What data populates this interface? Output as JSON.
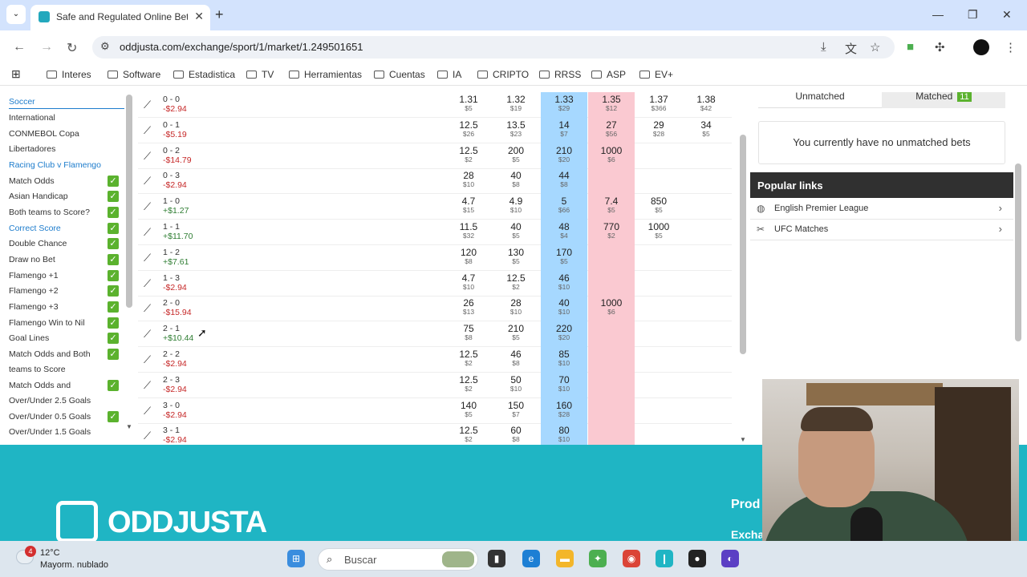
{
  "browser": {
    "tab_title": "Safe and Regulated Online Betti",
    "url": "oddjusta.com/exchange/sport/1/market/1.249501651"
  },
  "bookmarks": [
    "Interes",
    "Software",
    "Estadistica",
    "TV",
    "Herramientas",
    "Cuentas",
    "IA",
    "CRIPTO",
    "RRSS",
    "ASP",
    "EV+"
  ],
  "sidebar": {
    "items": [
      {
        "label": "Soccer",
        "style": "hl",
        "checked": false
      },
      {
        "label": "International",
        "style": "",
        "checked": false
      },
      {
        "label": "CONMEBOL Copa",
        "style": "",
        "checked": false
      },
      {
        "label": "Libertadores",
        "style": "",
        "checked": false
      },
      {
        "label": "Racing Club v Flamengo",
        "style": "hl",
        "checked": false
      },
      {
        "label": "Match Odds",
        "style": "",
        "checked": true
      },
      {
        "label": "Asian Handicap",
        "style": "",
        "checked": true
      },
      {
        "label": "Both teams to Score?",
        "style": "",
        "checked": true
      },
      {
        "label": "Correct Score",
        "style": "hl",
        "checked": true
      },
      {
        "label": "Double Chance",
        "style": "",
        "checked": true
      },
      {
        "label": "Draw no Bet",
        "style": "",
        "checked": true
      },
      {
        "label": "Flamengo +1",
        "style": "",
        "checked": true
      },
      {
        "label": "Flamengo +2",
        "style": "",
        "checked": true
      },
      {
        "label": "Flamengo +3",
        "style": "",
        "checked": true
      },
      {
        "label": "Flamengo Win to Nil",
        "style": "",
        "checked": true
      },
      {
        "label": "Goal Lines",
        "style": "",
        "checked": true
      },
      {
        "label": "Match Odds and Both",
        "style": "",
        "checked": true
      },
      {
        "label": "teams to Score",
        "style": "",
        "checked": false
      },
      {
        "label": "Match Odds and",
        "style": "",
        "checked": true
      },
      {
        "label": "Over/Under 2.5 Goals",
        "style": "",
        "checked": false
      },
      {
        "label": "Over/Under 0.5 Goals",
        "style": "",
        "checked": true
      },
      {
        "label": "Over/Under 1.5 Goals",
        "style": "",
        "checked": false
      }
    ]
  },
  "market": {
    "rows": [
      {
        "name": "0 - 0",
        "pl": "-$2.94",
        "pl_sign": "neg",
        "odds": [
          [
            "1.31",
            "$5"
          ],
          [
            "1.32",
            "$19"
          ],
          [
            "1.33",
            "$29"
          ],
          [
            "1.35",
            "$12"
          ],
          [
            "1.37",
            "$366"
          ],
          [
            "1.38",
            "$42"
          ]
        ]
      },
      {
        "name": "0 - 1",
        "pl": "-$5.19",
        "pl_sign": "neg",
        "odds": [
          [
            "12.5",
            "$26"
          ],
          [
            "13.5",
            "$23"
          ],
          [
            "14",
            "$7"
          ],
          [
            "27",
            "$56"
          ],
          [
            "29",
            "$28"
          ],
          [
            "34",
            "$5"
          ]
        ]
      },
      {
        "name": "0 - 2",
        "pl": "-$14.79",
        "pl_sign": "neg",
        "odds": [
          [
            "12.5",
            "$2"
          ],
          [
            "200",
            "$5"
          ],
          [
            "210",
            "$20"
          ],
          [
            "1000",
            "$6"
          ],
          [
            "",
            ""
          ],
          [
            "",
            ""
          ]
        ]
      },
      {
        "name": "0 - 3",
        "pl": "-$2.94",
        "pl_sign": "neg",
        "odds": [
          [
            "28",
            "$10"
          ],
          [
            "40",
            "$8"
          ],
          [
            "44",
            "$8"
          ],
          [
            "",
            ""
          ],
          [
            "",
            ""
          ],
          [
            "",
            ""
          ]
        ]
      },
      {
        "name": "1 - 0",
        "pl": "+$1.27",
        "pl_sign": "pos",
        "odds": [
          [
            "4.7",
            "$15"
          ],
          [
            "4.9",
            "$10"
          ],
          [
            "5",
            "$66"
          ],
          [
            "7.4",
            "$5"
          ],
          [
            "850",
            "$5"
          ],
          [
            "",
            ""
          ]
        ]
      },
      {
        "name": "1 - 1",
        "pl": "+$11.70",
        "pl_sign": "pos",
        "odds": [
          [
            "11.5",
            "$32"
          ],
          [
            "40",
            "$5"
          ],
          [
            "48",
            "$4"
          ],
          [
            "770",
            "$2"
          ],
          [
            "1000",
            "$5"
          ],
          [
            "",
            ""
          ]
        ]
      },
      {
        "name": "1 - 2",
        "pl": "+$7.61",
        "pl_sign": "pos",
        "odds": [
          [
            "120",
            "$8"
          ],
          [
            "130",
            "$5"
          ],
          [
            "170",
            "$5"
          ],
          [
            "",
            ""
          ],
          [
            "",
            ""
          ],
          [
            "",
            ""
          ]
        ]
      },
      {
        "name": "1 - 3",
        "pl": "-$2.94",
        "pl_sign": "neg",
        "odds": [
          [
            "4.7",
            "$10"
          ],
          [
            "12.5",
            "$2"
          ],
          [
            "46",
            "$10"
          ],
          [
            "",
            ""
          ],
          [
            "",
            ""
          ],
          [
            "",
            ""
          ]
        ]
      },
      {
        "name": "2 - 0",
        "pl": "-$15.94",
        "pl_sign": "neg",
        "odds": [
          [
            "26",
            "$13"
          ],
          [
            "28",
            "$10"
          ],
          [
            "40",
            "$10"
          ],
          [
            "1000",
            "$6"
          ],
          [
            "",
            ""
          ],
          [
            "",
            ""
          ]
        ]
      },
      {
        "name": "2 - 1",
        "pl": "+$10.44",
        "pl_sign": "pos",
        "odds": [
          [
            "75",
            "$8"
          ],
          [
            "210",
            "$5"
          ],
          [
            "220",
            "$20"
          ],
          [
            "",
            ""
          ],
          [
            "",
            ""
          ],
          [
            "",
            ""
          ]
        ]
      },
      {
        "name": "2 - 2",
        "pl": "-$2.94",
        "pl_sign": "neg",
        "odds": [
          [
            "12.5",
            "$2"
          ],
          [
            "46",
            "$8"
          ],
          [
            "85",
            "$10"
          ],
          [
            "",
            ""
          ],
          [
            "",
            ""
          ],
          [
            "",
            ""
          ]
        ]
      },
      {
        "name": "2 - 3",
        "pl": "-$2.94",
        "pl_sign": "neg",
        "odds": [
          [
            "12.5",
            "$2"
          ],
          [
            "50",
            "$10"
          ],
          [
            "70",
            "$10"
          ],
          [
            "",
            ""
          ],
          [
            "",
            ""
          ],
          [
            "",
            ""
          ]
        ]
      },
      {
        "name": "3 - 0",
        "pl": "-$2.94",
        "pl_sign": "neg",
        "odds": [
          [
            "140",
            "$5"
          ],
          [
            "150",
            "$7"
          ],
          [
            "160",
            "$28"
          ],
          [
            "",
            ""
          ],
          [
            "",
            ""
          ],
          [
            "",
            ""
          ]
        ]
      },
      {
        "name": "3 - 1",
        "pl": "-$2.94",
        "pl_sign": "neg",
        "odds": [
          [
            "12.5",
            "$2"
          ],
          [
            "60",
            "$8"
          ],
          [
            "80",
            "$10"
          ],
          [
            "",
            ""
          ],
          [
            "",
            ""
          ],
          [
            "",
            ""
          ]
        ]
      }
    ]
  },
  "bets_panel": {
    "tab_unmatched": "Unmatched",
    "tab_matched": "Matched",
    "matched_count": "11",
    "empty_message": "You currently have no unmatched bets"
  },
  "popular_links": {
    "title": "Popular links",
    "items": [
      {
        "label": "English Premier League",
        "icon": "globe-icon"
      },
      {
        "label": "UFC Matches",
        "icon": "fight-icon"
      }
    ]
  },
  "footer": {
    "logo_text": "ODDJUSTA",
    "col1": "Prod",
    "col2": "Excha"
  },
  "taskbar": {
    "weather_temp": "12°C",
    "weather_desc": "Mayorm. nublado",
    "weather_badge": "4",
    "search_placeholder": "Buscar"
  },
  "colors": {
    "back": "#a6d8ff",
    "lay": "#fac9d1",
    "accent": "#1fb5c4",
    "check": "#5bb22e"
  }
}
